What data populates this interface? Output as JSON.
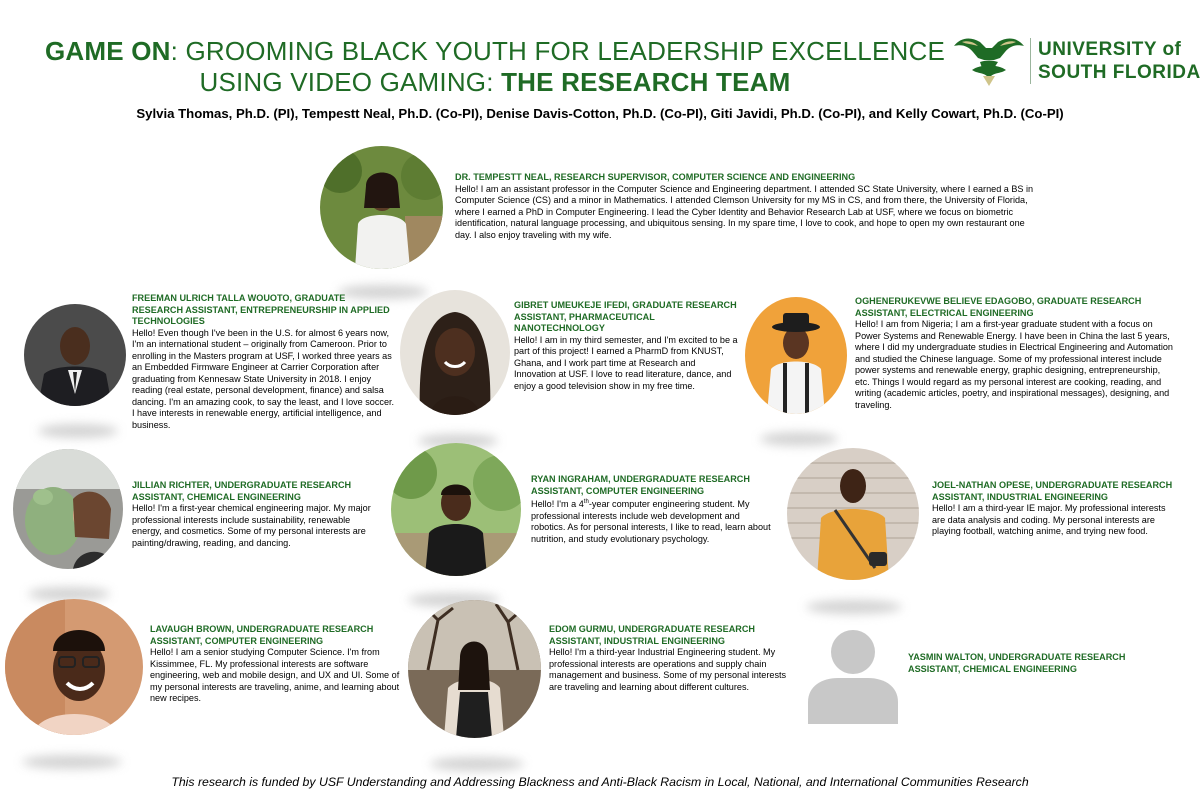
{
  "title": {
    "line1_bold": "GAME ON",
    "line1_rest": ": GROOMING BLACK YOUTH FOR LEADERSHIP EXCELLENCE",
    "line2_rest": "USING VIDEO GAMING: ",
    "line2_bold": "THE RESEARCH TEAM"
  },
  "logo": {
    "line1": "UNIVERSITY of",
    "line2": "SOUTH FLORIDA",
    "color": "#1f6b25"
  },
  "authors": "Sylvia Thomas, Ph.D. (PI), Tempestt Neal, Ph.D. (Co-PI), Denise Davis-Cotton, Ph.D. (Co-PI), Giti Javidi, Ph.D. (Co-PI), and Kelly Cowart, Ph.D. (Co-PI)",
  "members": [
    {
      "name": "DR. TEMPESTT NEAL, RESEARCH SUPERVISOR, COMPUTER SCIENCE AND ENGINEERING",
      "bio": "Hello! I am an assistant professor in the Computer Science and Engineering department. I attended SC State University, where I earned a BS in Computer Science (CS) and a minor in Mathematics. I attended Clemson University for my MS in CS, and from there, the University of Florida, where I earned a PhD in Computer Engineering. I lead the Cyber Identity and Behavior Research Lab at USF, where we focus on biometric identification, natural language processing, and ubiquitous sensing. In my spare time, I love to cook, and hope to open my own restaurant one day. I also enjoy traveling with my wife."
    },
    {
      "name": "FREEMAN ULRICH TALLA WOUOTO, GRADUATE RESEARCH ASSISTANT, ENTREPRENEURSHIP IN APPLIED TECHNOLOGIES",
      "bio": "Hello! Even though I've been in the U.S. for almost 6 years now, I'm an international student – originally from Cameroon. Prior to enrolling in the Masters program at USF, I worked three years as an Embedded Firmware Engineer at Carrier Corporation after graduating from Kennesaw State University in 2018. I enjoy reading (real estate, personal development, finance) and salsa dancing. I'm an amazing cook, to say the least, and I love soccer. I have interests in renewable energy, artificial intelligence, and business."
    },
    {
      "name": "GIBRET UMEUKEJE IFEDI, GRADUATE RESEARCH ASSISTANT, PHARMACEUTICAL NANOTECHNOLOGY",
      "bio": "Hello! I am in my third semester, and I'm excited to be a part of this project! I earned a PharmD from KNUST, Ghana, and I work part time at Research and Innovation at USF. I love to read literature, dance, and enjoy a good television show in my free time."
    },
    {
      "name": "OGHENERUKEVWE BELIEVE EDAGOBO, GRADUATE RESEARCH ASSISTANT, ELECTRICAL ENGINEERING",
      "bio": "Hello! I am from Nigeria; I am a first-year graduate student with a focus on Power Systems and Renewable Energy. I have been in China the last 5 years, where I did my undergraduate studies in Electrical Engineering and Automation and studied the Chinese language. Some of my professional interest include power systems and renewable energy, graphic designing, entrepreneurship, etc. Things I would regard as my personal interest are cooking, reading, and writing (academic articles, poetry, and inspirational messages), designing, and traveling."
    },
    {
      "name": "JILLIAN RICHTER, UNDERGRADUATE RESEARCH ASSISTANT, CHEMICAL ENGINEERING",
      "bio": "Hello! I'm a first-year chemical engineering major. My major professional interests include sustainability, renewable energy, and cosmetics. Some of my personal interests are painting/drawing, reading, and dancing."
    },
    {
      "name": "RYAN INGRAHAM, UNDERGRADUATE RESEARCH ASSISTANT, COMPUTER ENGINEERING",
      "bio_pre": "Hello! I'm a 4",
      "bio_sup": "th",
      "bio_post": "-year computer engineering student. My professional interests include web development and robotics. As for personal interests, I like to read, learn about nutrition, and study evolutionary psychology."
    },
    {
      "name": "JOEL-NATHAN OPESE, UNDERGRADUATE RESEARCH ASSISTANT, INDUSTRIAL ENGINEERING",
      "bio": "Hello! I am a third-year IE major. My professional interests are data analysis and coding. My personal interests are playing football, watching anime, and trying new food."
    },
    {
      "name": "LAVAUGH BROWN, UNDERGRADUATE RESEARCH ASSISTANT, COMPUTER ENGINEERING",
      "bio": "Hello! I am a senior studying Computer Science. I'm from Kissimmee, FL. My professional interests are software engineering, web and mobile design, and UX and UI. Some of my personal interests are traveling, anime, and learning about new recipes."
    },
    {
      "name": "EDOM GURMU, UNDERGRADUATE RESEARCH ASSISTANT, INDUSTRIAL ENGINEERING",
      "bio": "Hello! I'm a third-year Industrial Engineering student. My professional interests are operations and supply chain management and business. Some of my personal interests are traveling and learning about different cultures."
    },
    {
      "name": "YASMIN WALTON, UNDERGRADUATE RESEARCH ASSISTANT, CHEMICAL ENGINEERING"
    }
  ],
  "footer": "This research is funded by USF Understanding and Addressing Blackness and Anti-Black Racism in Local, National, and International Communities Research",
  "colors": {
    "usf_green": "#1f6b25",
    "placeholder_gray": "#c8c8c8"
  }
}
